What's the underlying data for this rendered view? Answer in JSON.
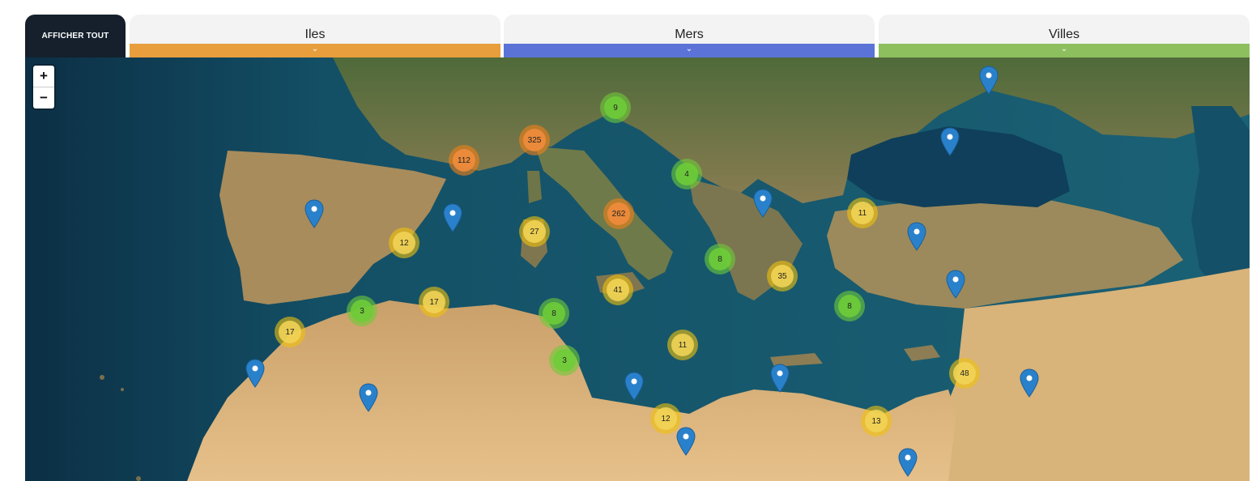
{
  "tabs": {
    "all_label": "AFFICHER TOUT",
    "categories": [
      {
        "label": "Iles",
        "color": "#e89e3c"
      },
      {
        "label": "Mers",
        "color": "#5b73d6"
      },
      {
        "label": "Villes",
        "color": "#8dbf5f"
      }
    ],
    "chevron": "⌄"
  },
  "map": {
    "zoom_in": "+",
    "zoom_out": "−",
    "clusters": [
      {
        "count": "9",
        "level": "low"
      },
      {
        "count": "325",
        "level": "high"
      },
      {
        "count": "112",
        "level": "high"
      },
      {
        "count": "4",
        "level": "low"
      },
      {
        "count": "262",
        "level": "high"
      },
      {
        "count": "27",
        "level": "mid"
      },
      {
        "count": "12",
        "level": "mid"
      },
      {
        "count": "11",
        "level": "mid"
      },
      {
        "count": "8",
        "level": "low"
      },
      {
        "count": "35",
        "level": "mid"
      },
      {
        "count": "41",
        "level": "mid"
      },
      {
        "count": "3",
        "level": "low"
      },
      {
        "count": "17",
        "level": "mid"
      },
      {
        "count": "8",
        "level": "low"
      },
      {
        "count": "17",
        "level": "mid"
      },
      {
        "count": "8",
        "level": "low"
      },
      {
        "count": "11",
        "level": "mid"
      },
      {
        "count": "3",
        "level": "low"
      },
      {
        "count": "48",
        "level": "mid"
      },
      {
        "count": "12",
        "level": "mid"
      },
      {
        "count": "13",
        "level": "mid"
      }
    ],
    "pins_count_note": "",
    "cluster_colors": {
      "low": {
        "outer": "rgba(110,204,57,0.6)",
        "inner": "rgba(110,204,57,0.9)"
      },
      "mid": {
        "outer": "rgba(240,194,12,0.6)",
        "inner": "rgba(241,211,87,0.9)"
      },
      "high": {
        "outer": "rgba(241,128,23,0.6)",
        "inner": "rgba(240,140,60,0.9)"
      }
    },
    "pin_color": "#2a81cb"
  }
}
